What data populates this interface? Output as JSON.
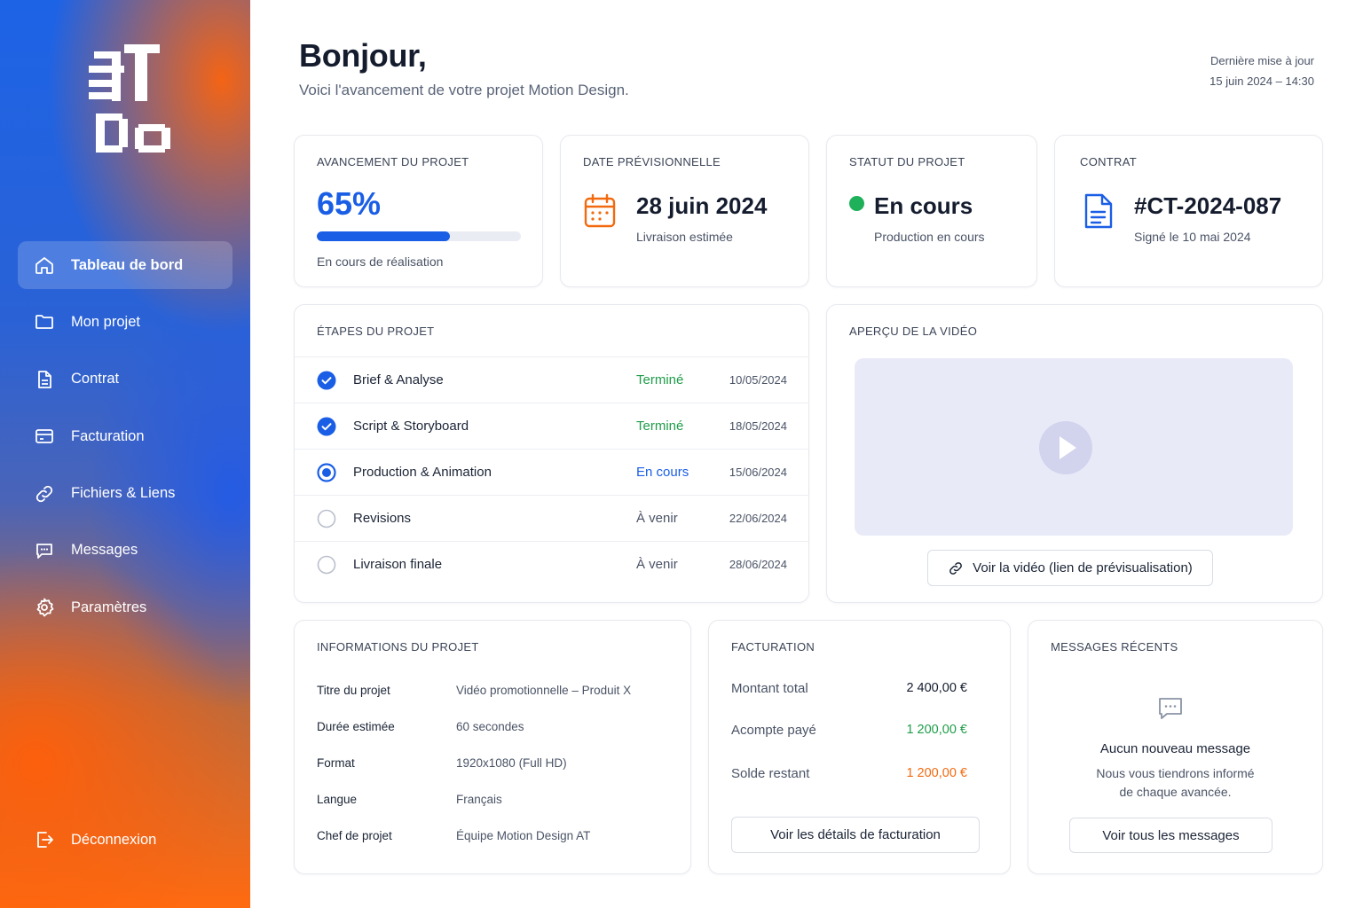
{
  "sidebar": {
    "logo_alt": "AT Do",
    "items": [
      {
        "label": "Tableau de bord",
        "icon": "home-icon",
        "active": true
      },
      {
        "label": "Mon projet",
        "icon": "folder-icon"
      },
      {
        "label": "Contrat",
        "icon": "document-icon"
      },
      {
        "label": "Facturation",
        "icon": "credit-card-icon"
      },
      {
        "label": "Fichiers & Liens",
        "icon": "link-icon"
      },
      {
        "label": "Messages",
        "icon": "chat-icon"
      },
      {
        "label": "Paramètres",
        "icon": "gear-icon"
      }
    ],
    "logout": {
      "label": "Déconnexion",
      "icon": "logout-icon"
    }
  },
  "header": {
    "title": "Bonjour,",
    "subtitle": "Voici l'avancement de votre projet Motion Design.",
    "updated_label": "Dernière mise à jour",
    "updated_value": "15 juin 2024 – 14:30"
  },
  "progress_card": {
    "label": "AVANCEMENT DU PROJET",
    "value": "65%",
    "fraction": 0.65,
    "note": "En cours de réalisation"
  },
  "date_card": {
    "label": "DATE PRÉVISIONNELLE",
    "value": "28 juin 2024",
    "sub": "Livraison estimée",
    "icon": "calendar-icon"
  },
  "status_card": {
    "label": "STATUT DU PROJET",
    "value": "En cours",
    "sub": "Production en cours",
    "color": "#1fb05a"
  },
  "contract_card": {
    "label": "CONTRAT",
    "value": "#CT-2024-087",
    "sub": "Signé le 10 mai 2024",
    "icon": "document-icon"
  },
  "steps": {
    "label": "ÉTAPES DU PROJET",
    "rows": [
      {
        "name": "Brief & Analyse",
        "status": "Terminé",
        "date": "10/05/2024",
        "state": "done"
      },
      {
        "name": "Script & Storyboard",
        "status": "Terminé",
        "date": "18/05/2024",
        "state": "done"
      },
      {
        "name": "Production & Animation",
        "status": "En cours",
        "date": "15/06/2024",
        "state": "current"
      },
      {
        "name": "Revisions",
        "status": "À venir",
        "date": "22/06/2024",
        "state": "todo"
      },
      {
        "name": "Livraison finale",
        "status": "À venir",
        "date": "28/06/2024",
        "state": "todo"
      }
    ],
    "colors": {
      "done": "#1f9d4a",
      "current": "#1a5ee6",
      "todo": "#4a5366"
    }
  },
  "video": {
    "label": "APERÇU DE LA VIDÉO",
    "button": "Voir la vidéo (lien de prévisualisation)"
  },
  "info": {
    "label": "INFORMATIONS DU PROJET",
    "rows": [
      {
        "key": "Titre du projet",
        "value": "Vidéo promotionnelle – Produit X"
      },
      {
        "key": "Durée estimée",
        "value": "60 secondes"
      },
      {
        "key": "Format",
        "value": "1920x1080 (Full HD)"
      },
      {
        "key": "Langue",
        "value": "Français"
      },
      {
        "key": "Chef de projet",
        "value": "Équipe Motion Design AT"
      }
    ]
  },
  "billing": {
    "label": "FACTURATION",
    "rows": [
      {
        "key": "Montant total",
        "value": "2 400,00 €",
        "color": "#141c2e"
      },
      {
        "key": "Acompte payé",
        "value": "1 200,00 €",
        "color": "#1f9d4a"
      },
      {
        "key": "Solde restant",
        "value": "1 200,00 €",
        "color": "#f26a10"
      }
    ],
    "button": "Voir les détails de facturation"
  },
  "messages": {
    "label": "MESSAGES RÉCENTS",
    "title": "Aucun nouveau message",
    "text_line1": "Nous vous tiendrons informé",
    "text_line2": "de chaque avancée.",
    "button": "Voir tous les messages"
  },
  "colors": {
    "accent": "#1a5ee6",
    "orange": "#ff6a10",
    "green": "#1fb05a"
  }
}
